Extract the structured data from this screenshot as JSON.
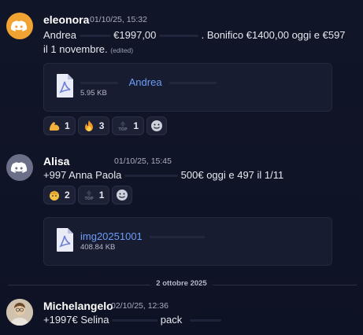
{
  "messages": [
    {
      "author": "eleonora",
      "timestamp": "01/10/25, 15:32",
      "text_line1_a": "Andrea",
      "text_line1_b": "€1997,00",
      "text_line1_c": ". Bonifico €1400,00 oggi e €597",
      "text_line2": "il 1 novembre.",
      "edited": "(edited)",
      "attachment": {
        "name": "Andrea",
        "size": "5.95 KB",
        "icon": "pdf-file-icon"
      },
      "reactions": [
        {
          "icon": "flexed-biceps-icon",
          "count": "1"
        },
        {
          "icon": "fire-icon",
          "count": "3"
        },
        {
          "icon": "top-arrow-icon",
          "count": "1"
        }
      ]
    },
    {
      "author": "Alisa",
      "timestamp": "01/10/25, 15:45",
      "text_a": "+997 Anna Paola",
      "text_b": "500€ oggi e 497 il 1/11",
      "reactions": [
        {
          "icon": "party-face-icon",
          "count": "2"
        },
        {
          "icon": "top-arrow-icon",
          "count": "1"
        }
      ],
      "attachment": {
        "name": "img20251001",
        "size": "408.84 KB",
        "icon": "pdf-file-icon"
      }
    },
    {
      "author": "Michelangelo",
      "timestamp": "02/10/25, 12:36",
      "text_a": "+1997€ Selina",
      "text_b": "pack"
    }
  ],
  "date_divider": "2 ottobre 2025",
  "colors": {
    "link": "#6e9df7",
    "background": "#111528",
    "discord_orange": "#f0a232"
  }
}
